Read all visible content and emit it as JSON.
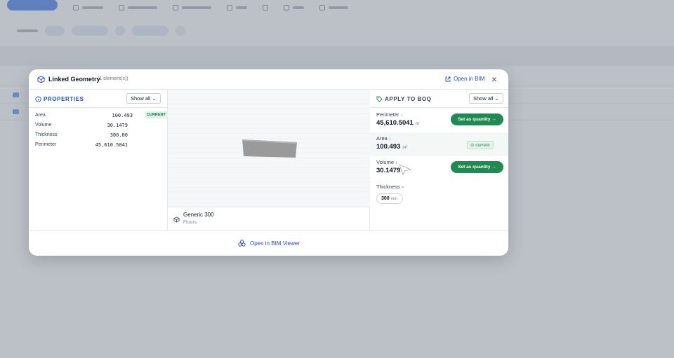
{
  "modal": {
    "title": "Linked Geometry",
    "count": "(1 element(s))",
    "open_bim": "Open in BIM",
    "close": "×"
  },
  "properties": {
    "title": "PROPERTIES",
    "show_all": "Show all",
    "rows": [
      {
        "label": "Area",
        "value": "100.493",
        "badge": "CURRENT"
      },
      {
        "label": "Volume",
        "value": "30.1479",
        "badge": ""
      },
      {
        "label": "Thickness",
        "value": "300.00",
        "badge": ""
      },
      {
        "label": "Perimeter",
        "value": "45,610.5041",
        "badge": ""
      }
    ]
  },
  "element": {
    "name": "Generic 300",
    "category": "Floors"
  },
  "apply": {
    "title": "APPLY TO BOQ",
    "show_all": "Show all",
    "rows": [
      {
        "label": "Perimeter",
        "value": "45,610.5041",
        "unit": "m",
        "action": "Set as quantity →"
      },
      {
        "label": "Area",
        "value": "100.493",
        "unit": "m²",
        "status": "current"
      },
      {
        "label": "Volume",
        "value": "30.1479",
        "unit": "",
        "action": "Set as quantity →"
      },
      {
        "label": "Thickness",
        "value": "300",
        "unit": "mm"
      }
    ]
  },
  "footer": {
    "open_viewer": "Open in BIM Viewer"
  },
  "colors": {
    "accent_blue": "#1d4ed8",
    "action_green": "#1f8a52",
    "current_green": "#16794a"
  }
}
